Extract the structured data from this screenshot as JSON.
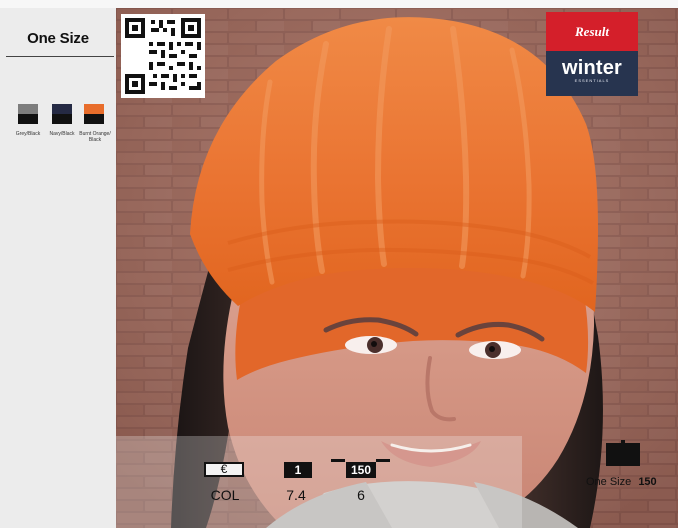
{
  "left_panel": {
    "size_title": "One Size",
    "swatches": [
      {
        "label_line1": "Grey/Black",
        "label_line2": "",
        "top_color": "#7d7d7d",
        "bottom_color": "#111111"
      },
      {
        "label_line1": "Navy/Black",
        "label_line2": "",
        "top_color": "#252a44",
        "bottom_color": "#111111"
      },
      {
        "label_line1": "Burnt Orange/",
        "label_line2": "Black",
        "top_color": "#e86d2b",
        "bottom_color": "#111111"
      }
    ]
  },
  "branding": {
    "top": "Result",
    "main": "winter",
    "sub": "ESSENTIALS",
    "top_color": "#d41f2a",
    "bottom_color": "#27344f"
  },
  "specs": {
    "currency_symbol": "€",
    "pack_qty": "1",
    "carton_qty": "150",
    "col_label": "COL",
    "weight_value": "7.4",
    "carton_value": "6",
    "right_size_label": "One Size",
    "right_size_value": "150"
  },
  "icons": {
    "qr": "qr-code-icon",
    "bag": "bag-icon"
  },
  "colors": {
    "panel_bg": "#ececec",
    "dark": "#111111",
    "hat_orange": "#e86d2b"
  }
}
